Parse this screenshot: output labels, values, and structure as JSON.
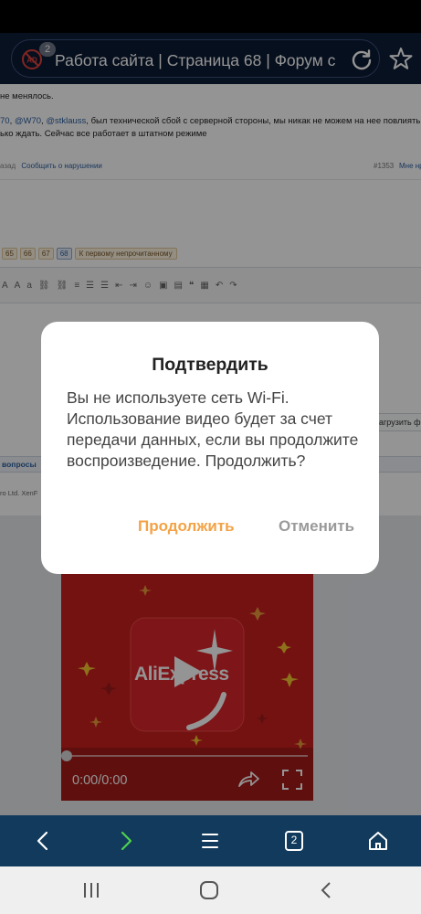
{
  "browser": {
    "url_title": "Работа сайта | Страница 68 | Форум с",
    "adblock_count": "2",
    "tab_count": "2"
  },
  "page": {
    "line1": "не менялось.",
    "mentions": [
      "70",
      "@W70",
      "@stklauss"
    ],
    "line2_text": ", был технической сбой с серверной стороны, мы никак не можем на нее повлиять,",
    "line3": "ько ждать. Сейчас все работает в штатном режиме",
    "back_link": "азад",
    "report_link": "Сообщить о нарушении",
    "post_number": "#1353",
    "post_next": "Мне нр",
    "pages": [
      "65",
      "66",
      "67",
      "68"
    ],
    "current_page": "68",
    "first_unread": "К первому непрочитанному",
    "upload_button": "агрузить фа",
    "questions_link": "вопросы",
    "copyright": "ro Ltd.     XenF"
  },
  "dialog": {
    "title": "Подтвердить",
    "message": "Вы не используете сеть Wi-Fi. Использование видео будет за счет передачи данных, если вы продолжите воспроизведение. Продолжить?",
    "continue_label": "Продолжить",
    "cancel_label": "Отменить"
  },
  "video": {
    "brand_text": "AliExpress",
    "time": "0:00/0:00",
    "progress": 0
  },
  "colors": {
    "accent_orange": "#f4a245",
    "cancel_gray": "#9a9a9a",
    "browser_bar": "#0f1e38",
    "bottom_nav": "#123a5c",
    "video_red": "#c8201e"
  }
}
